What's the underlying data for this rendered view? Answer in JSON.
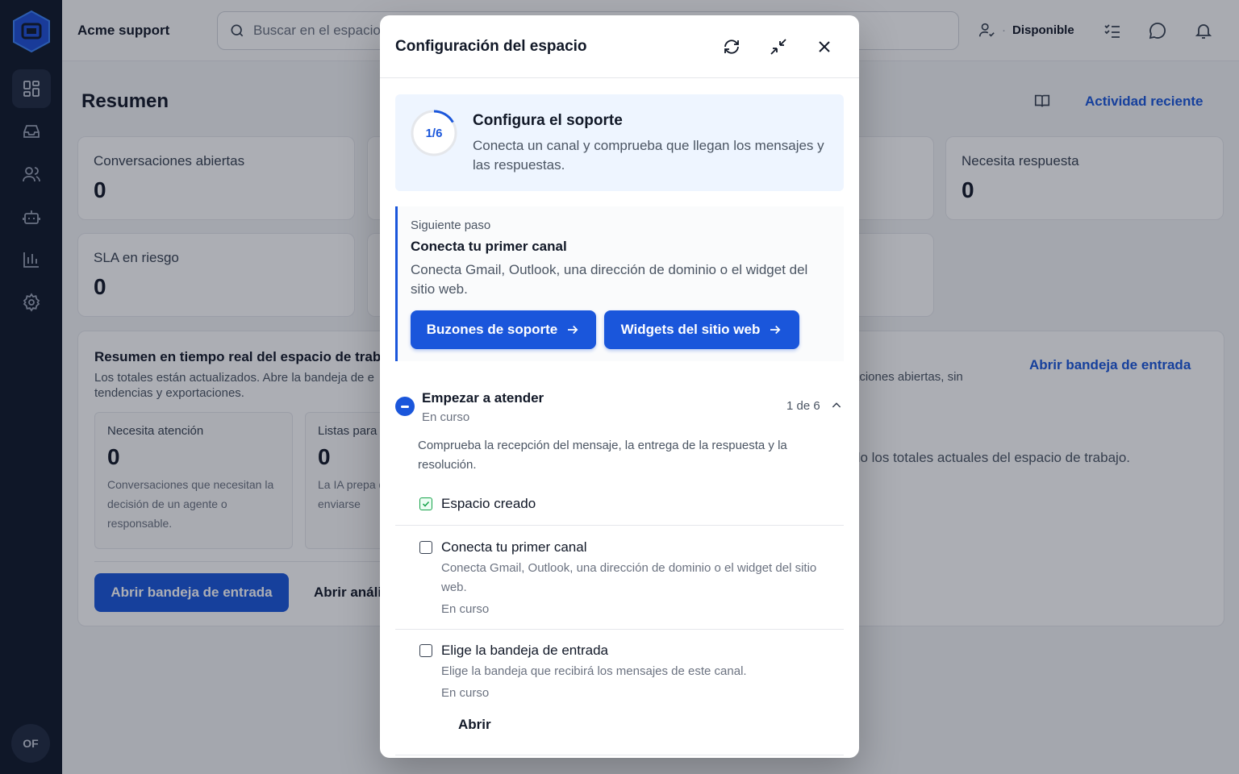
{
  "app": {
    "workspace_name": "Acme support",
    "avatar_initials": "OF"
  },
  "search": {
    "placeholder": "Buscar en el espacio"
  },
  "topbar": {
    "status": "Disponible"
  },
  "page": {
    "title": "Resumen",
    "recent_activity": "Actividad reciente"
  },
  "stats": {
    "open_label": "Conversaciones abiertas",
    "open_value": "0",
    "reply_label": "Necesita respuesta",
    "reply_value": "0",
    "sla_label": "SLA en riesgo",
    "sla_value": "0"
  },
  "panel": {
    "title": "Resumen en tiempo real del espacio de trab",
    "desc": "Los totales están actualizados. Abre la bandeja de e tendencias y exportaciones.",
    "right_link": "Abrir bandeja de entrada",
    "right_text": "aciones abiertas, sin",
    "right_text2": "do los totales actuales del espacio de trabajo.",
    "mini1": {
      "label": "Necesita atención",
      "value": "0",
      "desc": "Conversaciones que necesitan la decisión de un agente o responsable."
    },
    "mini2": {
      "label": "Listas para",
      "value": "0",
      "desc": "La IA prepa que necesit de enviarse"
    },
    "open_inbox": "Abrir bandeja de entrada",
    "open_analytics": "Abrir análi"
  },
  "modal": {
    "title": "Configuración del espacio",
    "progress": {
      "label": "1/6",
      "fraction": 0.1667
    },
    "hero_title": "Configura el soporte",
    "hero_desc": "Conecta un canal y comprueba que llegan los mensajes y las respuestas.",
    "next_kicker": "Siguiente paso",
    "next_title": "Conecta tu primer canal",
    "next_desc": "Conecta Gmail, Outlook, una dirección de dominio o el widget del sitio web.",
    "btn_mailboxes": "Buzones de soporte",
    "btn_widgets": "Widgets del sitio web",
    "section": {
      "title": "Empezar a atender",
      "status": "En curso",
      "count": "1 de 6",
      "desc": "Comprueba la recepción del mensaje, la entrega de la respuesta y la resolución."
    },
    "tasks": [
      {
        "title": "Espacio creado",
        "done": true
      },
      {
        "title": "Conecta tu primer canal",
        "desc": "Conecta Gmail, Outlook, una dirección de dominio o el widget del sitio web.",
        "status": "En curso",
        "done": false
      },
      {
        "title": "Elige la bandeja de entrada",
        "desc": "Elige la bandeja que recibirá los mensajes de este canal.",
        "status": "En curso",
        "done": false
      }
    ],
    "open_label": "Abrir"
  },
  "colors": {
    "accent": "#1a56db",
    "sidebar": "#0f1729",
    "success": "#16a34a"
  },
  "icons": [
    "logo-icon",
    "dashboard-icon",
    "inbox-icon",
    "users-icon",
    "bot-icon",
    "chart-icon",
    "gear-icon",
    "search-icon",
    "user-icon",
    "checklist-icon",
    "chat-icon",
    "bell-icon",
    "book-icon",
    "refresh-icon",
    "minimize-icon",
    "close-icon",
    "arrow-right-icon",
    "chevron-up-icon",
    "check-icon"
  ]
}
